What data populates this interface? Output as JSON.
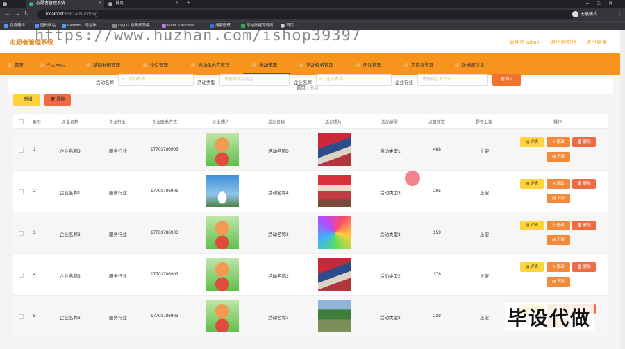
{
  "browser": {
    "tabs": [
      {
        "title": "志愿者管理系统"
      },
      {
        "title": "首页"
      }
    ],
    "new_tab": "+",
    "url_host": "localhost",
    "url_rest": ":8081/#/huodong",
    "profile": "无痕模式",
    "bookmarks": [
      "百度翻译",
      "图标网站",
      "Element - 网站快...",
      "Layui - 经典开源模...",
      "HTML5 Website T...",
      "搜索壁纸",
      "原始数据库规则",
      "首页"
    ]
  },
  "header": {
    "brand": "志愿者管理系统",
    "links": [
      "管理员 admin",
      "退出到前台",
      "退出登录"
    ]
  },
  "menu": [
    "首页",
    "个人中心",
    "基础数据管理",
    "论坛管理",
    "活动承办方管理",
    "活动管理",
    "活动报名管理",
    "团队管理",
    "志愿者管理",
    "轮播图信息"
  ],
  "breadcrumb": {
    "home": "首页",
    "sep": "/",
    "current": "活动"
  },
  "search": {
    "name_label": "活动名称",
    "name_placeholder": "活动名称",
    "type_label": "活动类型",
    "type_placeholder": "请选择活动类型",
    "company_label": "企业名称",
    "company_placeholder": "企业名称",
    "industry_label": "企业行业",
    "industry_placeholder": "请选择企业行业",
    "search_button": "查询"
  },
  "actions": {
    "new_button": "+ 新增",
    "delete_button": "删除"
  },
  "table": {
    "headers": [
      "索引",
      "企业名称",
      "企业行业",
      "企业联系方式",
      "企业照片",
      "活动名称",
      "活动照片",
      "活动类型",
      "点击次数",
      "是否上架",
      "操作"
    ],
    "rows": [
      {
        "index": "1",
        "company": "企业名称3",
        "industry": "服务行业",
        "phone": "17703786903",
        "company_photo": "mascot",
        "activity": "活动名称5",
        "activity_photo": "red-crowd",
        "type": "活动类型1",
        "clicks": "488",
        "shelf": "上架"
      },
      {
        "index": "2",
        "company": "企业名称1",
        "industry": "服务行业",
        "phone": "17703786901",
        "company_photo": "sky-person",
        "activity": "活动名称4",
        "activity_photo": "banner-crowd",
        "type": "活动类型3",
        "clicks": "265",
        "shelf": "上架"
      },
      {
        "index": "3",
        "company": "企业名称3",
        "industry": "服务行业",
        "phone": "17703786903",
        "company_photo": "mascot",
        "activity": "活动名称3",
        "activity_photo": "rainbow",
        "type": "活动类型3",
        "clicks": "159",
        "shelf": "上架"
      },
      {
        "index": "4",
        "company": "企业名称3",
        "industry": "服务行业",
        "phone": "17703786903",
        "company_photo": "mascot",
        "activity": "活动名称2",
        "activity_photo": "red-crowd",
        "type": "活动类型2",
        "clicks": "378",
        "shelf": "上架"
      },
      {
        "index": "5",
        "company": "企业名称3",
        "industry": "服务行业",
        "phone": "17703786903",
        "company_photo": "mascot",
        "activity": "活动名称1",
        "activity_photo": "park",
        "type": "活动类型3",
        "clicks": "228",
        "shelf": "上架"
      }
    ],
    "row_actions": {
      "detail": "详情",
      "edit": "修改",
      "remove": "删除",
      "off": "下架"
    }
  },
  "watermarks": {
    "top": "https://www.huzhan.com/ishop39397",
    "bottom_right": "毕设代做"
  },
  "colors": {
    "menu_bg": "#f7941d",
    "brand": "#e0861a",
    "search_btn": "#f0732d",
    "new_btn": "#ffd33b",
    "delete_btn": "#ef6b45"
  }
}
